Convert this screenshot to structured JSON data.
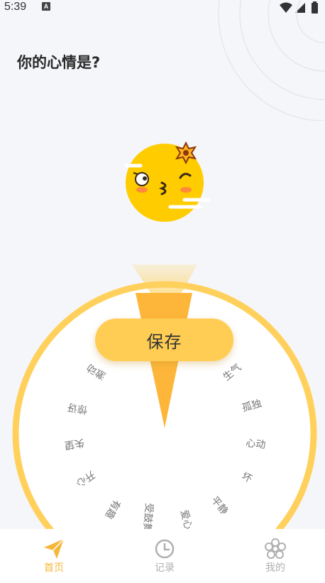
{
  "status": {
    "time": "5:39",
    "notification_letter": "A"
  },
  "page": {
    "title": "你的心情是?"
  },
  "wheel": {
    "moods": [
      "激动",
      "惊讶",
      "失望",
      "开心",
      "有趣",
      "受鼓舞",
      "爱心",
      "平静",
      "坏",
      "心动",
      "孤独",
      "生气"
    ],
    "colors": {
      "ring": "#ffd15c",
      "pointer": "#fdb63a"
    }
  },
  "actions": {
    "save_label": "保存"
  },
  "nav": {
    "items": [
      {
        "label": "首页",
        "icon": "paper-plane-icon",
        "active": true
      },
      {
        "label": "记录",
        "icon": "clock-icon",
        "active": false
      },
      {
        "label": "我的",
        "icon": "flower-icon",
        "active": false
      }
    ],
    "active_color": "#f5b73a",
    "inactive_color": "#b0b0b0"
  }
}
